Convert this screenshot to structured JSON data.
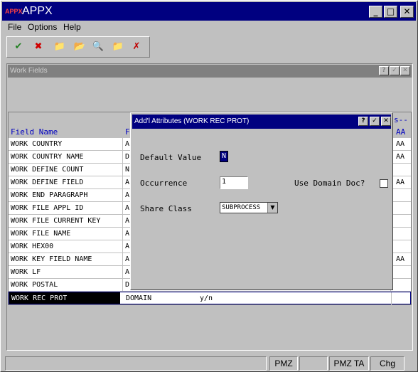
{
  "app": {
    "title": "APPX",
    "icon_text": "APPX",
    "controls": {
      "minimize": "_",
      "maximize": "□",
      "close": "✕"
    }
  },
  "menu": {
    "items": [
      "File",
      "Options",
      "Help"
    ]
  },
  "toolbar": {
    "icons": [
      "ok-check-icon",
      "cancel-icon",
      "new-folder-icon",
      "folder-edit-icon",
      "folder-search-icon",
      "folder-delete-icon",
      "folder-cancel-icon"
    ],
    "glyphs": [
      "✔",
      "✖",
      "📁",
      "📂",
      "🔍",
      "📁",
      "✗"
    ]
  },
  "child_window": {
    "title": "Work Fields",
    "controls": {
      "help": "?",
      "ok": "✓",
      "close": "✕"
    }
  },
  "grid": {
    "headers": {
      "name": "Field Name",
      "type": "F",
      "right_top": "s--",
      "right": "AA"
    },
    "rows": [
      {
        "name": "WORK COUNTRY",
        "type": "A",
        "aa": "AA"
      },
      {
        "name": "WORK COUNTRY NAME",
        "type": "D",
        "aa": "AA"
      },
      {
        "name": "WORK DEFINE COUNT",
        "type": "N",
        "aa": ""
      },
      {
        "name": "WORK DEFINE FIELD",
        "type": "A",
        "aa": "AA"
      },
      {
        "name": "WORK END PARAGRAPH",
        "type": "A",
        "aa": ""
      },
      {
        "name": "WORK FILE APPL ID",
        "type": "A",
        "aa": ""
      },
      {
        "name": "WORK FILE CURRENT KEY",
        "type": "A",
        "aa": ""
      },
      {
        "name": "WORK FILE NAME",
        "type": "A",
        "aa": ""
      },
      {
        "name": "WORK HEX00",
        "type": "A",
        "aa": ""
      },
      {
        "name": "WORK KEY FIELD NAME",
        "type": "A",
        "aa": "AA"
      },
      {
        "name": "WORK LF",
        "type": "A",
        "aa": ""
      },
      {
        "name": "WORK POSTAL",
        "type": "D",
        "aa": ""
      }
    ],
    "selected_row": {
      "name": "WORK REC PROT",
      "type": "DOMAIN",
      "extra": "y/n"
    }
  },
  "dialog": {
    "title": "Add'l Attributes  (WORK REC PROT)",
    "controls": {
      "help": "?",
      "ok": "✓",
      "close": "✕"
    },
    "default_value_label": "Default Value",
    "default_value": "N",
    "occurrence_label": "Occurrence",
    "occurrence_value": "1",
    "use_domain_doc_label": "Use Domain Doc?",
    "use_domain_doc_checked": false,
    "share_class_label": "Share Class",
    "share_class_value": "SUBPROCESS",
    "share_class_arrow": "▼"
  },
  "status": {
    "cells": [
      "",
      "PMZ",
      "",
      "PMZ TA",
      "Chg"
    ]
  }
}
